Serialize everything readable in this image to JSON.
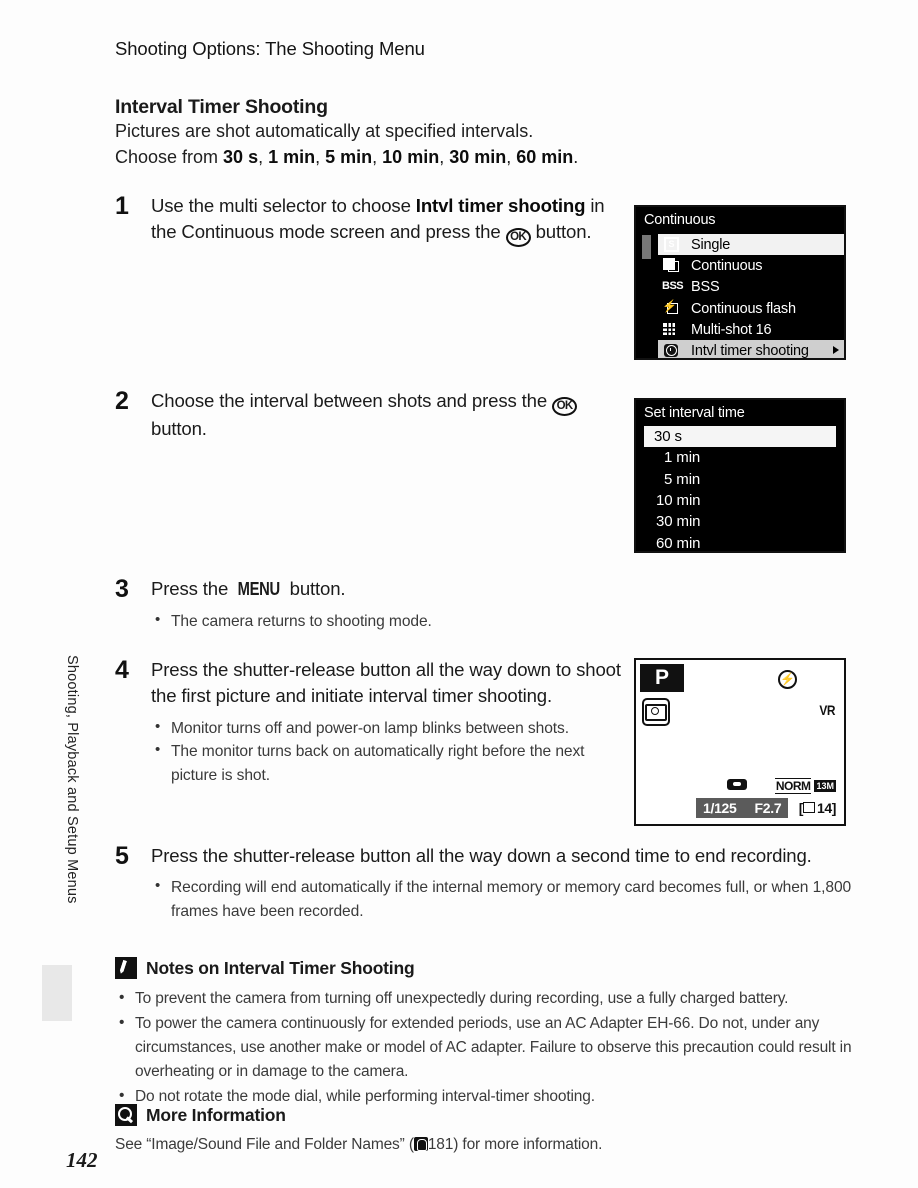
{
  "running_head": "Shooting Options: The Shooting Menu",
  "section": {
    "title": "Interval Timer Shooting",
    "intro_line1": "Pictures are shot automatically at specified intervals.",
    "intro_choose_prefix": "Choose from ",
    "intervals": [
      "30 s",
      "1 min",
      "5 min",
      "10 min",
      "30 min",
      "60 min"
    ]
  },
  "steps": {
    "s1": {
      "num": "1",
      "text_a": "Use the multi selector to choose ",
      "text_b": "Intvl timer shooting",
      "text_c": " in the Continuous mode screen and press the ",
      "ok": "OK",
      "text_d": " button."
    },
    "s2": {
      "num": "2",
      "text_a": "Choose the interval between shots and press the ",
      "ok": "OK",
      "text_b": " button."
    },
    "s3": {
      "num": "3",
      "text_a": "Press the ",
      "menu": "MENU",
      "text_b": " button.",
      "bullets": [
        "The camera returns to shooting mode."
      ]
    },
    "s4": {
      "num": "4",
      "text": "Press the shutter-release button all the way down to shoot the first picture and initiate interval timer shooting.",
      "bullets": [
        "Monitor turns off and power-on lamp blinks between shots.",
        "The monitor turns back on automatically right before the next picture is shot."
      ]
    },
    "s5": {
      "num": "5",
      "text": "Press the shutter-release button all the way down a second time to end recording.",
      "bullets": [
        "Recording will end automatically if the internal memory or memory card becomes full, or when 1,800 frames have been recorded."
      ]
    }
  },
  "notes": {
    "heading": "Notes on Interval Timer Shooting",
    "items": [
      "To prevent the camera from turning off unexpectedly during recording, use a fully charged battery.",
      "To power the camera continuously for extended periods, use an AC Adapter EH-66. Do not, under any circumstances, use another make or model of AC adapter. Failure to observe this precaution could result in overheating or in damage to the camera.",
      "Do not rotate the mode dial, while performing interval-timer shooting."
    ]
  },
  "more_info": {
    "heading": "More Information",
    "text_a": "See “Image/Sound File and Folder Names” (",
    "page_ref": "181",
    "text_b": ") for more information."
  },
  "side_tab": "Shooting, Playback and Setup Menus",
  "page_number": "142",
  "lcd_continuous": {
    "title": "Continuous",
    "items": [
      {
        "label": "Single",
        "icon": "single-frame-icon"
      },
      {
        "label": "Continuous",
        "icon": "continuous-frames-icon"
      },
      {
        "label": "BSS",
        "icon": "bss-icon"
      },
      {
        "label": "Continuous flash",
        "icon": "continuous-flash-icon"
      },
      {
        "label": "Multi-shot 16",
        "icon": "multi-shot-grid-icon"
      },
      {
        "label": "Intvl timer shooting",
        "icon": "interval-timer-clock-icon"
      }
    ]
  },
  "lcd_interval": {
    "title": "Set interval time",
    "items": [
      "30 s",
      "1 min",
      "5 min",
      "10 min",
      "30 min",
      "60 min"
    ],
    "selected": "30 s"
  },
  "lcd_shooting": {
    "mode": "P",
    "vr": "VR",
    "quality": "NORM",
    "image_size": "13M",
    "shutter_speed": "1/125",
    "aperture": "F2.7",
    "frames_remaining": "14"
  }
}
